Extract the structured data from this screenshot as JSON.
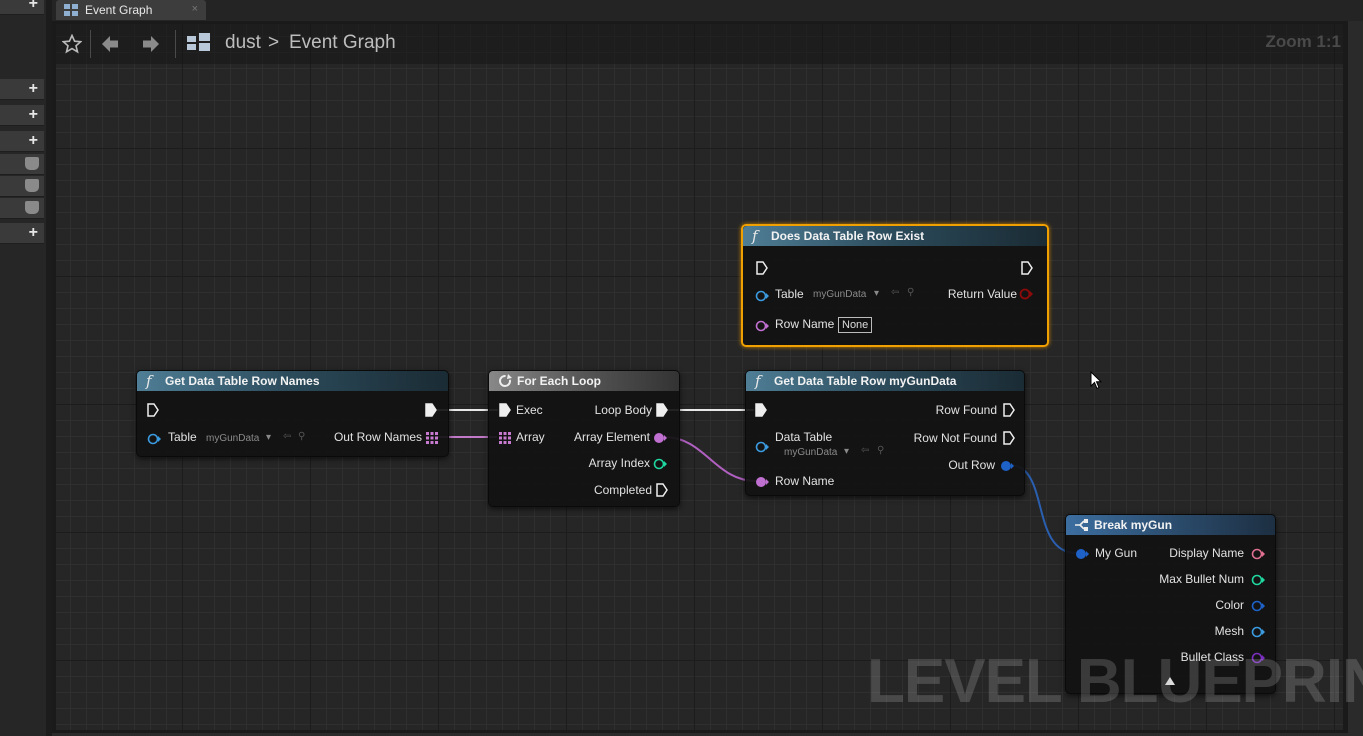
{
  "tab": {
    "label": "Event Graph",
    "close": "×"
  },
  "breadcrumb": {
    "root": "dust",
    "sep": ">",
    "current": "Event Graph"
  },
  "zoom": "Zoom 1:1",
  "watermark": "LEVEL BLUEPRINT",
  "nodes": {
    "does_exist": {
      "title": "Does Data Table Row Exist",
      "table_label": "Table",
      "table_value": "myGunData",
      "row_name_label": "Row Name",
      "row_name_value": "None",
      "return_label": "Return Value"
    },
    "get_names": {
      "title": "Get Data Table Row Names",
      "table_label": "Table",
      "table_value": "myGunData",
      "out_label": "Out Row Names"
    },
    "for_each": {
      "title": "For Each Loop",
      "exec": "Exec",
      "array": "Array",
      "loop_body": "Loop Body",
      "array_element": "Array Element",
      "array_index": "Array Index",
      "completed": "Completed"
    },
    "get_row": {
      "title": "Get Data Table Row myGunData",
      "data_table": "Data Table",
      "table_value": "myGunData",
      "row_name": "Row Name",
      "row_found": "Row Found",
      "row_not_found": "Row Not Found",
      "out_row": "Out Row"
    },
    "break": {
      "title": "Break myGun",
      "my_gun": "My Gun",
      "display_name": "Display Name",
      "max_bullet": "Max Bullet Num",
      "color": "Color",
      "mesh": "Mesh",
      "bullet_class": "Bullet Class"
    }
  }
}
